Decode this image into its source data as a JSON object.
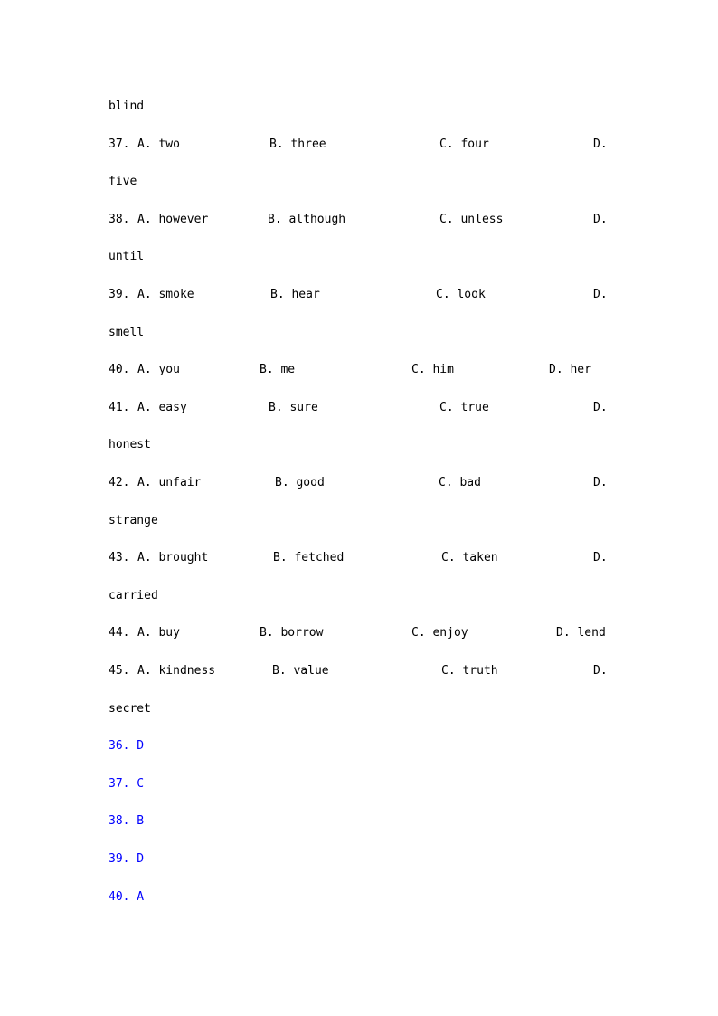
{
  "q36_tail": "blind",
  "questions": [
    {
      "num": "37.",
      "a": "A. two",
      "b": "B. three",
      "c": "C. four",
      "d": "D.",
      "d_wrap": "five"
    },
    {
      "num": "38.",
      "a": "A. however",
      "b": "B. although",
      "c": "C. unless",
      "d": "D.",
      "d_wrap": "until"
    },
    {
      "num": "39.",
      "a": "A. smoke",
      "b": "B. hear",
      "c": "C. look",
      "d": "D.",
      "d_wrap": "smell"
    },
    {
      "num": "40.",
      "a": "A. you",
      "b": "B. me",
      "c": "C. him",
      "d": "D. her",
      "d_wrap": ""
    },
    {
      "num": "41.",
      "a": "A. easy",
      "b": "B. sure",
      "c": "C. true",
      "d": "D.",
      "d_wrap": "honest"
    },
    {
      "num": "42.",
      "a": "A. unfair",
      "b": "B. good",
      "c": "C. bad",
      "d": "D.",
      "d_wrap": "strange"
    },
    {
      "num": "43.",
      "a": "A. brought",
      "b": "B. fetched",
      "c": "C. taken",
      "d": "D.",
      "d_wrap": "carried"
    },
    {
      "num": "44.",
      "a": "A. buy",
      "b": "B. borrow",
      "c": "C. enjoy",
      "d": "D. lend",
      "d_wrap": ""
    },
    {
      "num": "45.",
      "a": "A. kindness",
      "b": "B. value",
      "c": "C. truth",
      "d": "D.",
      "d_wrap": "secret"
    }
  ],
  "answers": [
    "36. D",
    "37. C",
    "38. B",
    "39. D",
    "40. A"
  ],
  "colors": {
    "text": "#000000",
    "answer": "#0000ff"
  }
}
